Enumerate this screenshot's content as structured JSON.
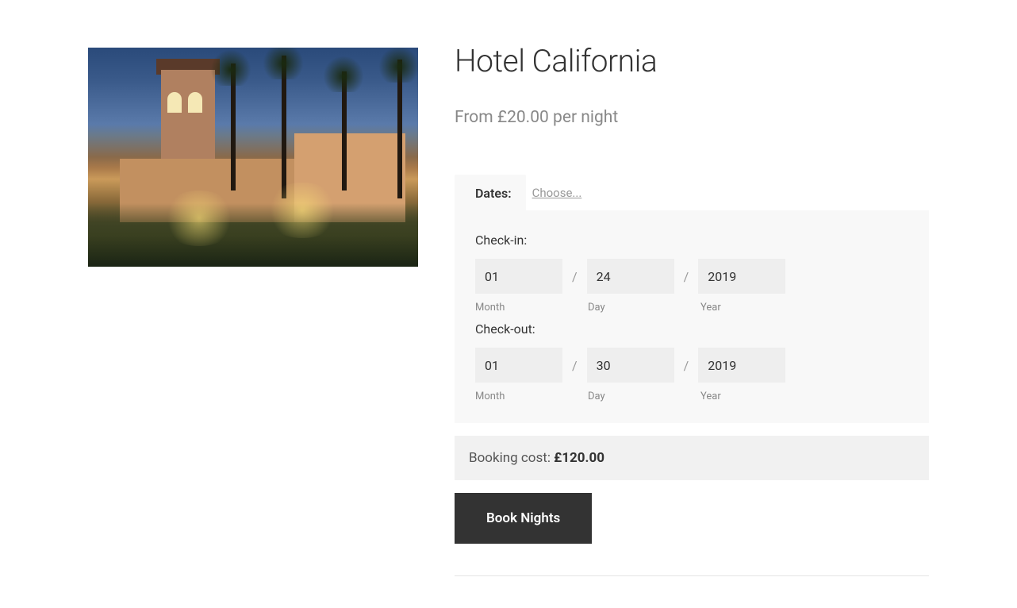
{
  "product": {
    "title": "Hotel California",
    "price_line": "From £20.00 per night"
  },
  "tabs": {
    "dates_label": "Dates:",
    "choose_label": "Choose..."
  },
  "checkin": {
    "label": "Check-in:",
    "month": "01",
    "day": "24",
    "year": "2019"
  },
  "checkout": {
    "label": "Check-out:",
    "month": "01",
    "day": "30",
    "year": "2019"
  },
  "sublabels": {
    "month": "Month",
    "day": "Day",
    "year": "Year"
  },
  "cost": {
    "label": "Booking cost: ",
    "value": "£120.00"
  },
  "button": {
    "label": "Book Nights"
  }
}
